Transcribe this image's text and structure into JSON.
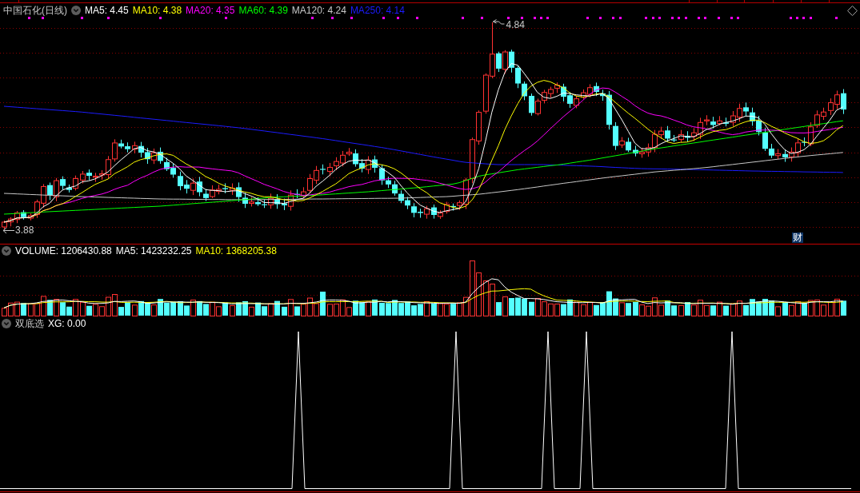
{
  "price_panel": {
    "title": "中国石化(日线)",
    "indicators": [
      {
        "label": "MA5: 4.45",
        "color": "#ffffff"
      },
      {
        "label": "MA10: 4.38",
        "color": "#ffff00"
      },
      {
        "label": "MA20: 4.35",
        "color": "#ff00ff"
      },
      {
        "label": "MA60: 4.39",
        "color": "#00ff00"
      },
      {
        "label": "MA120: 4.24",
        "color": "#c8c8c8"
      },
      {
        "label": "MA250: 4.14",
        "color": "#1c1cff"
      }
    ],
    "high_label": "4.84",
    "low_label": "3.88",
    "badge": "财"
  },
  "volume_panel": {
    "indicators": [
      {
        "label": "VOLUME: 1206430.88",
        "color": "#ffffff"
      },
      {
        "label": "MA5: 1423232.25",
        "color": "#ffffff"
      },
      {
        "label": "MA10: 1368205.38",
        "color": "#ffff00"
      }
    ]
  },
  "indicator_panel": {
    "title": "双底选",
    "indicators": [
      {
        "label": "XG: 0.00",
        "color": "#ffffff"
      }
    ]
  }
}
